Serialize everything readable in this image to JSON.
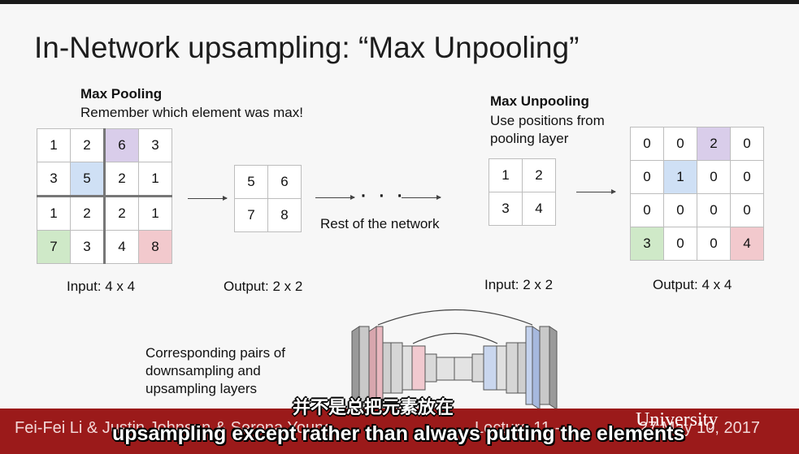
{
  "slide": {
    "title": "In-Network upsampling: “Max Unpooling”"
  },
  "max_pooling": {
    "heading": "Max Pooling",
    "subheading": "Remember which element was max!",
    "input_grid": [
      [
        "1",
        "2",
        "6",
        "3"
      ],
      [
        "3",
        "5",
        "2",
        "1"
      ],
      [
        "1",
        "2",
        "2",
        "1"
      ],
      [
        "7",
        "3",
        "4",
        "8"
      ]
    ],
    "input_label": "Input: 4 x 4",
    "output_grid": [
      [
        "5",
        "6"
      ],
      [
        "7",
        "8"
      ]
    ],
    "output_label": "Output: 2 x 2",
    "ellipsis": "· · ·",
    "rest_label": "Rest of the network"
  },
  "max_unpooling": {
    "heading": "Max Unpooling",
    "subheading_line1": "Use positions from",
    "subheading_line2": "pooling layer",
    "input_grid": [
      [
        "1",
        "2"
      ],
      [
        "3",
        "4"
      ]
    ],
    "input_label": "Input: 2 x 2",
    "output_grid": [
      [
        "0",
        "0",
        "2",
        "0"
      ],
      [
        "0",
        "1",
        "0",
        "0"
      ],
      [
        "0",
        "0",
        "0",
        "0"
      ],
      [
        "3",
        "0",
        "0",
        "4"
      ]
    ],
    "output_label": "Output: 4 x 4"
  },
  "diagram": {
    "caption_line1": "Corresponding pairs of",
    "caption_line2": "downsampling and",
    "caption_line3": "upsampling layers"
  },
  "footer": {
    "authors": "Fei-Fei Li & Justin Johnson & Serena Young",
    "lecture": "Lecture 11 -",
    "date": "27 May 10, 2017",
    "watermark": "University"
  },
  "subtitles": {
    "zh": "并不是总把元素放在",
    "en": "upsampling except rather than always putting the elements"
  },
  "colors": {
    "purple": "#d9cdea",
    "blue": "#cfe0f5",
    "green": "#cfe9c8",
    "red": "#f2c9cd",
    "footer": "#9b1a1a"
  }
}
